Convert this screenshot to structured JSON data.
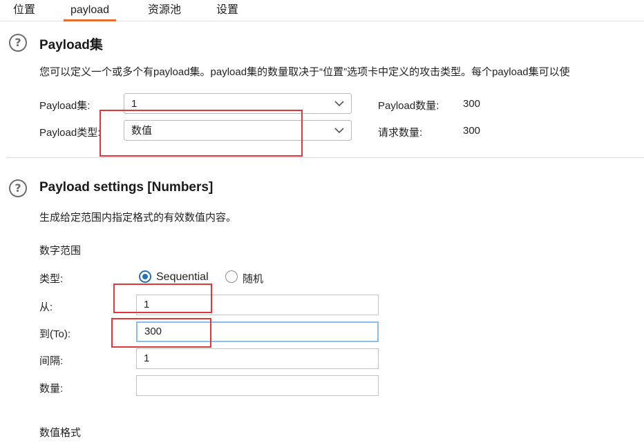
{
  "tabs": [
    {
      "label": "位置",
      "active": false
    },
    {
      "label": "payload",
      "active": true
    },
    {
      "label": "资源池",
      "active": false
    },
    {
      "label": "设置",
      "active": false
    }
  ],
  "payload_sets": {
    "title": "Payload集",
    "description": "您可以定义一个或多个有payload集。payload集的数量取决于“位置”选项卡中定义的攻击类型。每个payload集可以使",
    "set_label": "Payload集:",
    "set_value": "1",
    "type_label": "Payload类型:",
    "type_value": "数值",
    "count_label": "Payload数量:",
    "count_value": "300",
    "requests_label": "请求数量:",
    "requests_value": "300"
  },
  "payload_settings": {
    "title": "Payload settings [Numbers]",
    "description": "生成给定范围内指定格式的有效数值内容。",
    "range_heading": "数字范围",
    "type_label": "类型:",
    "type_options": [
      {
        "label": "Sequential",
        "selected": true
      },
      {
        "label": "随机",
        "selected": false
      }
    ],
    "from_label": "从:",
    "from_value": "1",
    "to_label": "到(To):",
    "to_value": "300",
    "step_label": "间隔:",
    "step_value": "1",
    "count_label": "数量:",
    "count_value": "",
    "format_heading": "数值格式"
  },
  "colors": {
    "accent_tab": "#ec6a2d",
    "annotation_red": "#e0363a",
    "radio_blue": "#2a6fb5",
    "focus_border": "#8cbde6"
  },
  "icons": [
    "help-icon",
    "chevron-down-icon"
  ]
}
